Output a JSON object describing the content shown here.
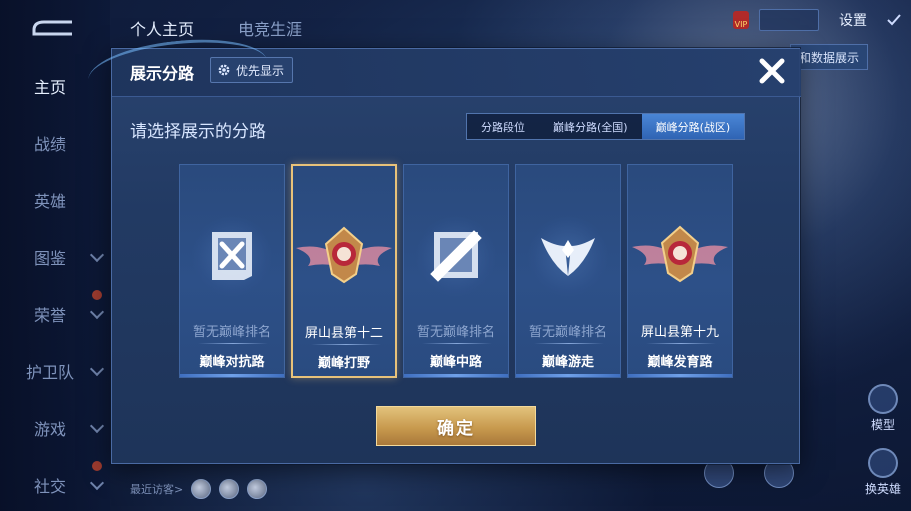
{
  "nav": {
    "items": [
      {
        "label": "主页",
        "active": true,
        "chevron": false,
        "badge": false
      },
      {
        "label": "战绩",
        "active": false,
        "chevron": false,
        "badge": false
      },
      {
        "label": "英雄",
        "active": false,
        "chevron": false,
        "badge": false
      },
      {
        "label": "图鉴",
        "active": false,
        "chevron": true,
        "badge": false
      },
      {
        "label": "荣誉",
        "active": false,
        "chevron": true,
        "badge": true
      },
      {
        "label": "护卫队",
        "active": false,
        "chevron": true,
        "badge": false
      },
      {
        "label": "游戏",
        "active": false,
        "chevron": true,
        "badge": false
      },
      {
        "label": "社交",
        "active": false,
        "chevron": true,
        "badge": true
      }
    ]
  },
  "top_tabs": [
    "个人主页",
    "电竞生涯"
  ],
  "top_right": {
    "settings_label": "设置",
    "vip_label": "VIP"
  },
  "data_display_label": "和数据展示",
  "right_side": {
    "label_1": "模型",
    "label_2": "换英雄"
  },
  "bottom": {
    "visitors_label": "最近访客>"
  },
  "modal": {
    "title": "展示分路",
    "priority_label": "优先显示",
    "section_title": "请选择展示的分路",
    "tabs": [
      "分路段位",
      "巅峰分路(全国)",
      "巅峰分路(战区)"
    ],
    "active_tab": 2,
    "cards": [
      {
        "rank": "暂无巅峰排名",
        "lane": "巅峰对抗路",
        "has_rank": false,
        "selected": false,
        "icon": "sword-lane-icon"
      },
      {
        "rank": "屏山县第十二",
        "lane": "巅峰打野",
        "has_rank": true,
        "selected": true,
        "icon": "winged-badge-icon"
      },
      {
        "rank": "暂无巅峰排名",
        "lane": "巅峰中路",
        "has_rank": false,
        "selected": false,
        "icon": "mid-lane-icon"
      },
      {
        "rank": "暂无巅峰排名",
        "lane": "巅峰游走",
        "has_rank": false,
        "selected": false,
        "icon": "wings-shield-icon"
      },
      {
        "rank": "屏山县第十九",
        "lane": "巅峰发育路",
        "has_rank": true,
        "selected": false,
        "icon": "winged-badge-icon"
      }
    ],
    "confirm_label": "确定"
  },
  "colors": {
    "accent_gold": "#e8c27a",
    "tab_active": "#3a76c8",
    "panel": "#223a63"
  }
}
